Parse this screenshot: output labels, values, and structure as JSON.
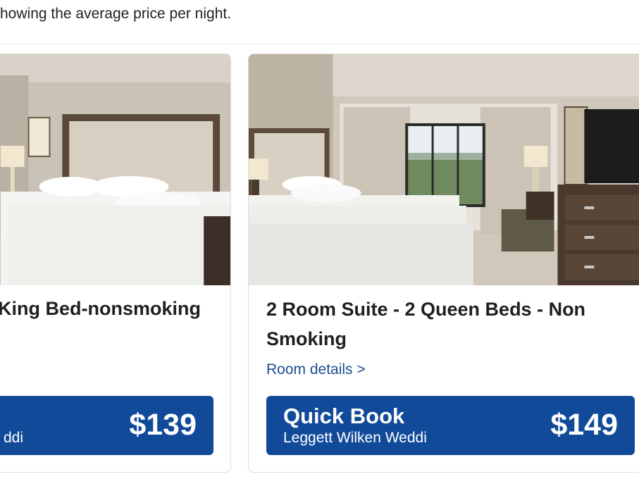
{
  "notice": "howing the average price per night.",
  "rooms": [
    {
      "title": "King Bed-nonsmoking",
      "room_details": "",
      "quick_book": {
        "title": "",
        "subtitle": "ddi",
        "price": "$139"
      }
    },
    {
      "title": "2 Room Suite - 2 Queen Beds - Non Smoking",
      "room_details": "Room details >",
      "quick_book": {
        "title": "Quick Book",
        "subtitle": "Leggett Wilken Weddi",
        "price": "$149"
      }
    }
  ]
}
